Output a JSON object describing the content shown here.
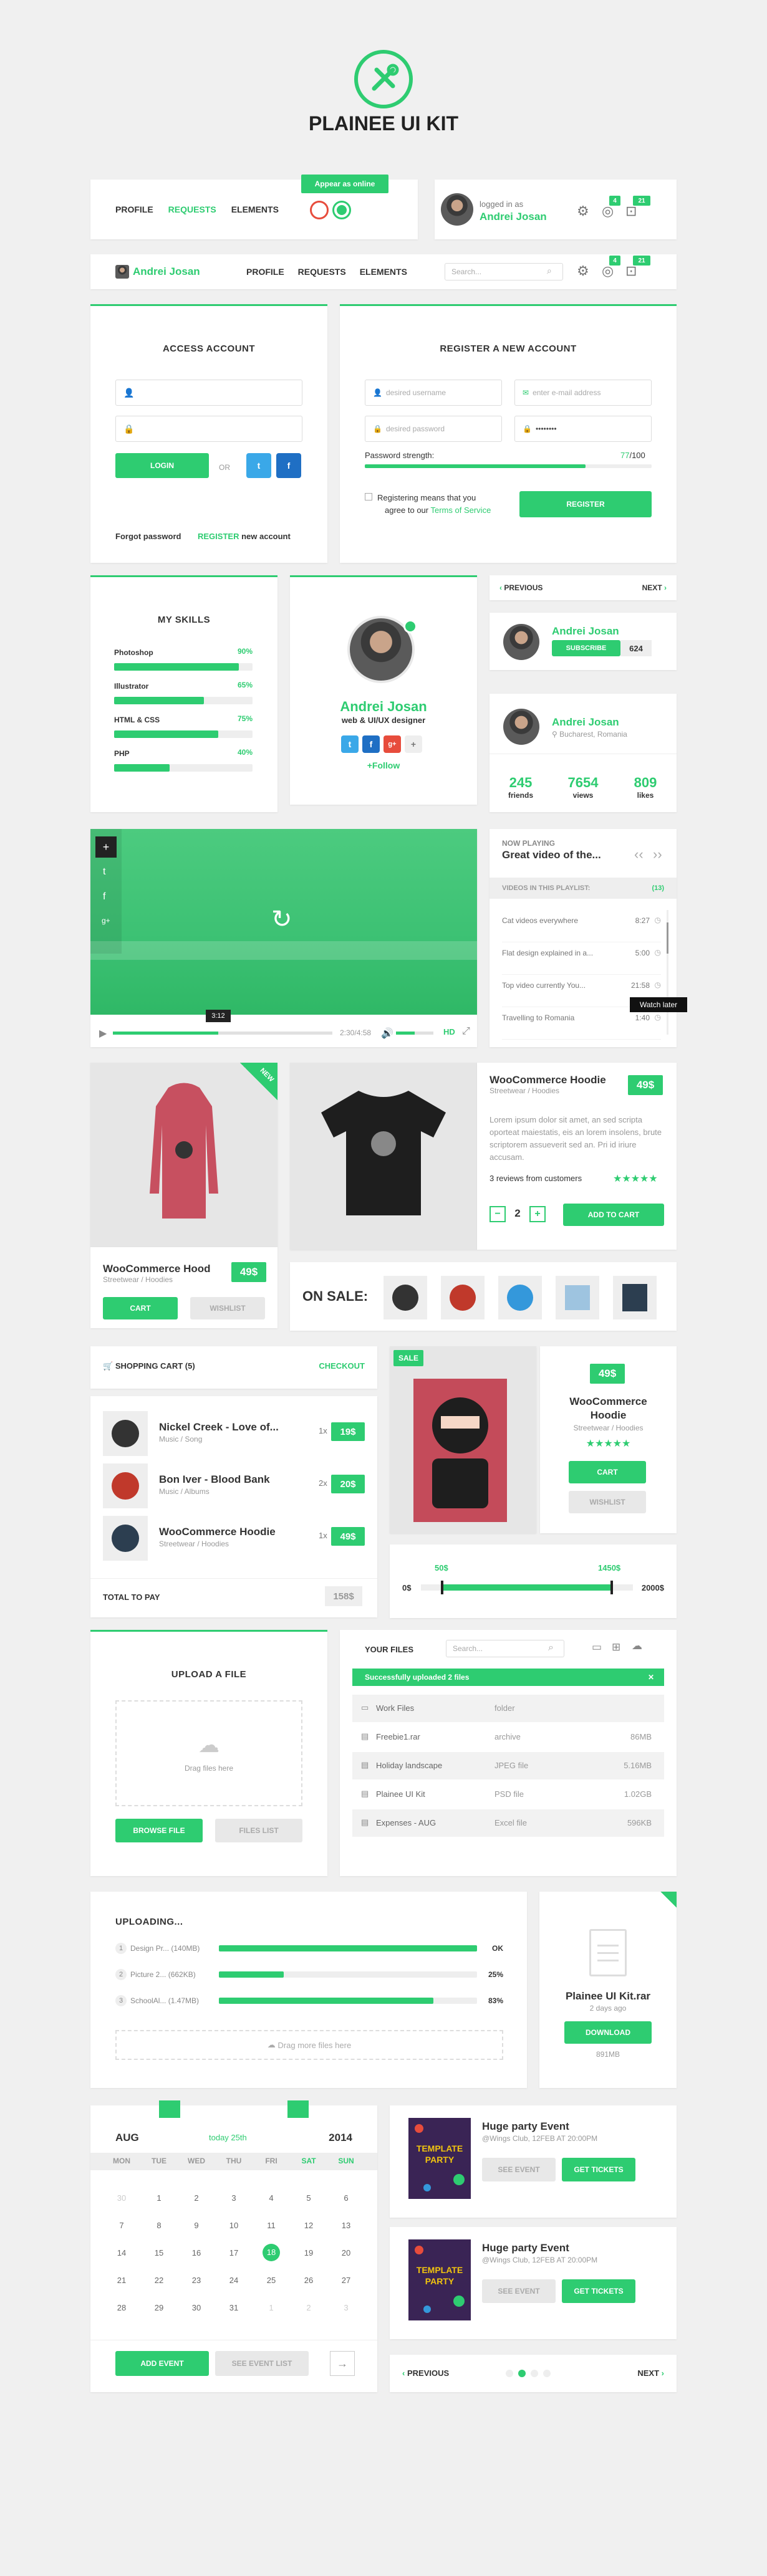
{
  "header": {
    "title": "PLAINEE UI KIT",
    "logo_icon": "tools-icon"
  },
  "colors": {
    "accent": "#2ecc71",
    "dark": "#222222",
    "red": "#e74c3c"
  },
  "nav1": {
    "items": [
      "PROFILE",
      "REQUESTS",
      "ELEMENTS"
    ],
    "tooltip": "Appear as online"
  },
  "user": {
    "logged_in": "logged in as",
    "name": "Andrei Josan",
    "badge1": "4",
    "badge2": "21"
  },
  "nav2": {
    "name": "Andrei Josan",
    "items": [
      "PROFILE",
      "REQUESTS",
      "ELEMENTS"
    ],
    "search": "Search..."
  },
  "access": {
    "title": "ACCESS ACCOUNT",
    "login": "LOGIN",
    "or": "OR",
    "forgot": "Forgot password",
    "register": "REGISTER",
    "new_account": "new account"
  },
  "register": {
    "title": "REGISTER A NEW ACCOUNT",
    "username": "desired username",
    "email": "enter e-mail address",
    "password": "desired password",
    "password2": "••••••••",
    "strength_label": "Password strength:",
    "strength_val": "77",
    "strength_max": "/100",
    "strength_fill": 0.77,
    "terms1": "Registering means that you",
    "terms2": "agree to our",
    "terms_link": "Terms of Service",
    "button": "REGISTER"
  },
  "skills": {
    "title": "MY SKILLS",
    "items": [
      {
        "name": "Photoshop",
        "pct": "90%",
        "v": 0.9
      },
      {
        "name": "Illustrator",
        "pct": "65%",
        "v": 0.65
      },
      {
        "name": "HTML & CSS",
        "pct": "75%",
        "v": 0.75
      },
      {
        "name": "PHP",
        "pct": "40%",
        "v": 0.4
      }
    ]
  },
  "profile": {
    "name": "Andrei Josan",
    "role": "web & UI/UX designer",
    "follow": "+Follow"
  },
  "pager1": {
    "prev": "PREVIOUS",
    "next": "NEXT"
  },
  "subscribe": {
    "name": "Andrei Josan",
    "button": "SUBSCRIBE",
    "count": "624"
  },
  "stats": {
    "name": "Andrei Josan",
    "location": "Bucharest, Romania",
    "items": [
      {
        "v": "245",
        "l": "friends"
      },
      {
        "v": "7654",
        "l": "views"
      },
      {
        "v": "809",
        "l": "likes"
      }
    ]
  },
  "video": {
    "time_tip": "3:12",
    "time": "2:30/4:58",
    "hd": "HD",
    "progress": 0.48
  },
  "playlist": {
    "now": "NOW PLAYING",
    "title": "Great video of the...",
    "header": "VIDEOS IN THIS PLAYLIST:",
    "count": "(13)",
    "items": [
      {
        "t": "Cat videos everywhere",
        "d": "8:27"
      },
      {
        "t": "Flat design explained in a...",
        "d": "5:00"
      },
      {
        "t": "Top video currently You...",
        "d": "21:58"
      },
      {
        "t": "Travelling to Romania",
        "d": "1:40"
      }
    ],
    "watch_later": "Watch later"
  },
  "product1": {
    "name": "WooCommerce Hood",
    "cat": "Streetwear / Hoodies",
    "price": "49$",
    "cart": "CART",
    "wish": "WISHLIST",
    "new": "NEW"
  },
  "product2": {
    "name": "WooCommerce Hoodie",
    "cat": "Streetwear / Hoodies",
    "price": "49$",
    "desc": "Lorem ipsum dolor sit amet, an sed scripta oporteat maiestatis, eis an lorem insolens, brute scriptorem assueverit sed an. Pri id iriure accusam.",
    "reviews": "3 reviews from customers",
    "qty": "2",
    "add": "ADD TO CART",
    "stars": 4
  },
  "onsale": {
    "label": "ON SALE:"
  },
  "cart": {
    "title": "SHOPPING CART (5)",
    "checkout": "CHECKOUT",
    "items": [
      {
        "n": "Nickel Creek - Love of...",
        "c": "Music / Song",
        "q": "1x",
        "p": "19$"
      },
      {
        "n": "Bon Iver - Blood Bank",
        "c": "Music / Albums",
        "q": "2x",
        "p": "20$"
      },
      {
        "n": "WooCommerce Hoodie",
        "c": "Streetwear / Hoodies",
        "q": "1x",
        "p": "49$"
      }
    ],
    "total_label": "TOTAL TO PAY",
    "total": "158$"
  },
  "sale": {
    "tag": "SALE",
    "price": "49$",
    "name": "WooCommerce Hoodie",
    "cat": "Streetwear / Hoodies",
    "cart": "CART",
    "wish": "WISHLIST",
    "stars": 4
  },
  "range": {
    "lo": "50$",
    "hi": "1450$",
    "min": "0$",
    "max": "2000$",
    "lo_v": 0.1,
    "hi_v": 0.9
  },
  "upload": {
    "title": "UPLOAD A FILE",
    "drag": "Drag files here",
    "browse": "BROWSE FILE",
    "list": "FILES LIST"
  },
  "files": {
    "title": "YOUR FILES",
    "search": "Search...",
    "success": "Successfully uploaded 2 files",
    "rows": [
      {
        "n": "Work Files",
        "t": "folder",
        "s": ""
      },
      {
        "n": "Freebie1.rar",
        "t": "archive",
        "s": "86MB"
      },
      {
        "n": "Holiday landscape",
        "t": "JPEG file",
        "s": "5.16MB"
      },
      {
        "n": "Plainee UI Kit",
        "t": "PSD file",
        "s": "1.02GB"
      },
      {
        "n": "Expenses - AUG",
        "t": "Excel file",
        "s": "596KB"
      }
    ]
  },
  "uploading": {
    "title": "UPLOADING...",
    "items": [
      {
        "i": "1",
        "n": "Design Pr... (140MB)",
        "v": 1,
        "s": "OK"
      },
      {
        "i": "2",
        "n": "Picture 2... (662KB)",
        "v": 0.25,
        "s": "25%"
      },
      {
        "i": "3",
        "n": "SchoolAl... (1.47MB)",
        "v": 0.83,
        "s": "83%"
      }
    ],
    "drag": "Drag more files here"
  },
  "download": {
    "name": "Plainee UI Kit.rar",
    "ago": "2 days ago",
    "button": "DOWNLOAD",
    "size": "891MB"
  },
  "calendar": {
    "month": "AUG",
    "today": "today 25th",
    "year": "2014",
    "days": [
      "MON",
      "TUE",
      "WED",
      "THU",
      "FRI",
      "SAT",
      "SUN"
    ],
    "weeks": [
      [
        "30",
        "1",
        "2",
        "3",
        "4",
        "5",
        "6"
      ],
      [
        "7",
        "8",
        "9",
        "10",
        "11",
        "12",
        "13"
      ],
      [
        "14",
        "15",
        "16",
        "17",
        "18",
        "19",
        "20"
      ],
      [
        "21",
        "22",
        "23",
        "24",
        "25",
        "26",
        "27"
      ],
      [
        "28",
        "29",
        "30",
        "31",
        "1",
        "2",
        "3"
      ]
    ],
    "add": "ADD EVENT",
    "list": "SEE EVENT LIST"
  },
  "events": [
    {
      "title": "Huge party Event",
      "where": "@Wings Club, 12FEB AT 20:00PM",
      "see": "SEE EVENT",
      "get": "GET TICKETS",
      "poster": "TEMPLATE PARTY"
    },
    {
      "title": "Huge party Event",
      "where": "@Wings Club, 12FEB AT 20:00PM",
      "see": "SEE EVENT",
      "get": "GET TICKETS",
      "poster": "TEMPLATE PARTY"
    }
  ],
  "pager2": {
    "prev": "PREVIOUS",
    "next": "NEXT"
  }
}
